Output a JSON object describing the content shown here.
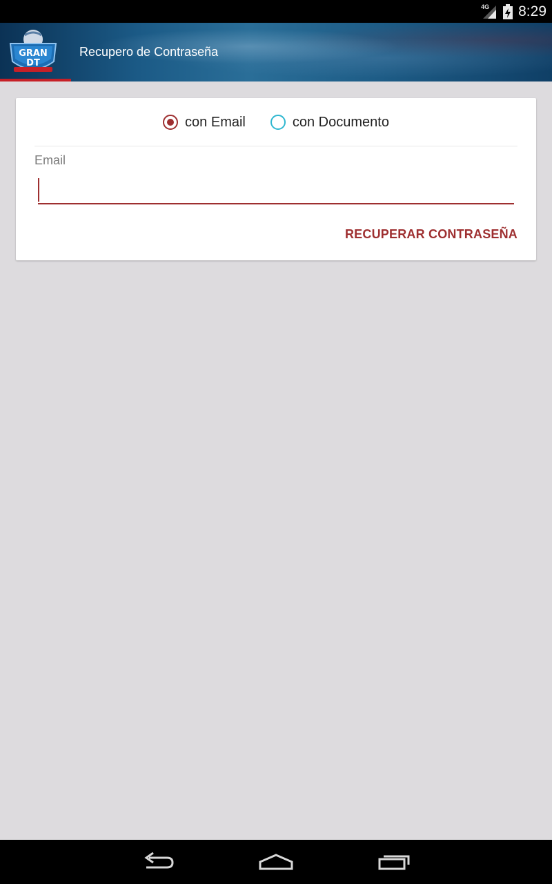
{
  "status_bar": {
    "network": "4G",
    "time": "8:29",
    "icons": [
      "signal-icon",
      "battery-icon"
    ]
  },
  "app_bar": {
    "logo": {
      "name": "gran-dt-logo",
      "text_top": "GRAN",
      "text_bottom": "DT"
    },
    "title": "Recupero de Contraseña"
  },
  "form": {
    "radio_options": [
      {
        "label": "con Email",
        "selected": true
      },
      {
        "label": "con Documento",
        "selected": false
      }
    ],
    "email_label": "Email",
    "email_value": "",
    "submit_label": "RECUPERAR CONTRASEÑA"
  },
  "nav_bar": {
    "icons": [
      "back-icon",
      "home-icon",
      "recent-apps-icon"
    ]
  },
  "colors": {
    "accent": "#9e2f30",
    "radio_unchecked": "#2fb7d0",
    "background": "#dddbde",
    "app_bar": "#1b5a86",
    "app_bar_accent": "#c62027"
  }
}
